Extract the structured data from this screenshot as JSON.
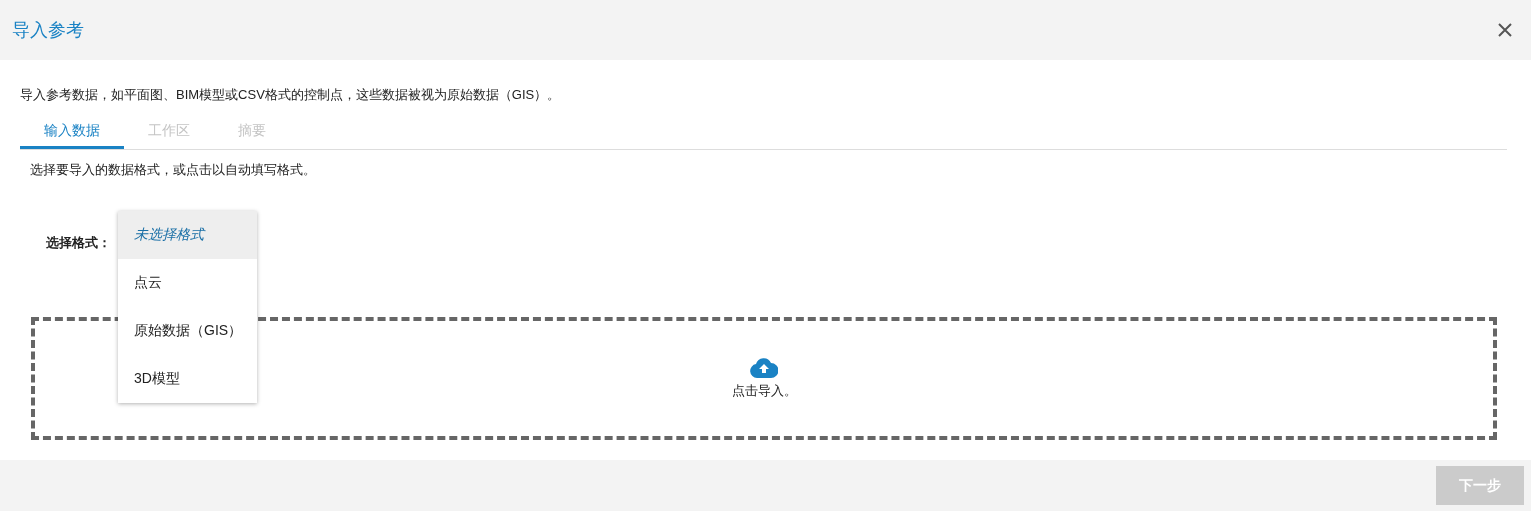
{
  "window": {
    "title": "导入参考"
  },
  "description": "导入参考数据，如平面图、BIM模型或CSV格式的控制点，这些数据被视为原始数据（GIS）。",
  "tabs": [
    {
      "label": "输入数据",
      "selected": true,
      "disabled": false
    },
    {
      "label": "工作区",
      "selected": false,
      "disabled": true
    },
    {
      "label": "摘要",
      "selected": false,
      "disabled": true
    }
  ],
  "instruction": "选择要导入的数据格式，或点击以自动填写格式。",
  "format_select": {
    "label": "选择格式：",
    "expanded": true,
    "options": [
      {
        "text": "未选择格式",
        "kind": "placeholder",
        "selected": true
      },
      {
        "text": "点云",
        "kind": "option",
        "selected": false
      },
      {
        "text": "原始数据（GIS）",
        "kind": "option",
        "selected": false
      },
      {
        "text": "3D模型",
        "kind": "option",
        "selected": false
      }
    ]
  },
  "drop_zone": {
    "text": "点击导入。"
  },
  "buttons": [
    {
      "label": "下一步",
      "disabled": true
    }
  ]
}
